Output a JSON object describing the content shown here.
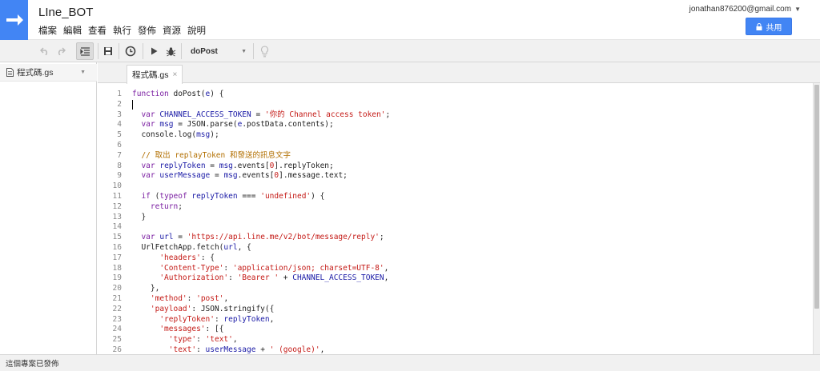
{
  "app": {
    "title": "LIne_BOT"
  },
  "menu": [
    "檔案",
    "編輯",
    "查看",
    "執行",
    "發佈",
    "資源",
    "說明"
  ],
  "account": {
    "email": "jonathan876200@gmail.com"
  },
  "share": {
    "label": "共用"
  },
  "toolbar": {
    "function_select": "doPost",
    "icons": [
      "undo-icon",
      "redo-icon",
      "indent-icon",
      "save-icon",
      "clock-icon",
      "run-icon",
      "debug-icon",
      "lightbulb-icon"
    ]
  },
  "sidebar": {
    "file": "程式碼.gs"
  },
  "tab": {
    "label": "程式碼.gs",
    "close": "×"
  },
  "code": {
    "line_numbers": [
      "1",
      "2",
      "3",
      "4",
      "5",
      "6",
      "7",
      "8",
      "9",
      "10",
      "11",
      "12",
      "13",
      "14",
      "15",
      "16",
      "17",
      "18",
      "19",
      "20",
      "21",
      "22",
      "23",
      "24",
      "25",
      "26"
    ],
    "lines": [
      [
        [
          "k",
          "function "
        ],
        [
          "n",
          "doPost("
        ],
        [
          "v",
          "e"
        ],
        [
          "n",
          ") {"
        ]
      ],
      [
        [
          "cursor",
          ""
        ]
      ],
      [
        [
          "n",
          "  "
        ],
        [
          "k",
          "var "
        ],
        [
          "v",
          "CHANNEL_ACCESS_TOKEN"
        ],
        [
          "n",
          " = "
        ],
        [
          "s",
          "'你的 Channel access token'"
        ],
        [
          "n",
          ";"
        ]
      ],
      [
        [
          "n",
          "  "
        ],
        [
          "k",
          "var "
        ],
        [
          "v",
          "msg"
        ],
        [
          "n",
          " = JSON.parse("
        ],
        [
          "v",
          "e"
        ],
        [
          "n",
          ".postData.contents);"
        ]
      ],
      [
        [
          "n",
          "  console.log("
        ],
        [
          "v",
          "msg"
        ],
        [
          "n",
          ");"
        ]
      ],
      [
        [
          "n",
          ""
        ]
      ],
      [
        [
          "c",
          "  // 取出 replayToken 和發送的訊息文字"
        ]
      ],
      [
        [
          "n",
          "  "
        ],
        [
          "k",
          "var "
        ],
        [
          "v",
          "replyToken"
        ],
        [
          "n",
          " = "
        ],
        [
          "v",
          "msg"
        ],
        [
          "n",
          ".events["
        ],
        [
          "s",
          "0"
        ],
        [
          "n",
          "].replyToken;"
        ]
      ],
      [
        [
          "n",
          "  "
        ],
        [
          "k",
          "var "
        ],
        [
          "v",
          "userMessage"
        ],
        [
          "n",
          " = "
        ],
        [
          "v",
          "msg"
        ],
        [
          "n",
          ".events["
        ],
        [
          "s",
          "0"
        ],
        [
          "n",
          "].message.text;"
        ]
      ],
      [
        [
          "n",
          ""
        ]
      ],
      [
        [
          "n",
          "  "
        ],
        [
          "k",
          "if "
        ],
        [
          "n",
          "("
        ],
        [
          "k",
          "typeof "
        ],
        [
          "v",
          "replyToken"
        ],
        [
          "n",
          " === "
        ],
        [
          "s",
          "'undefined'"
        ],
        [
          "n",
          ") {"
        ]
      ],
      [
        [
          "n",
          "    "
        ],
        [
          "k",
          "return"
        ],
        [
          "n",
          ";"
        ]
      ],
      [
        [
          "n",
          "  }"
        ]
      ],
      [
        [
          "n",
          ""
        ]
      ],
      [
        [
          "n",
          "  "
        ],
        [
          "k",
          "var "
        ],
        [
          "v",
          "url"
        ],
        [
          "n",
          " = "
        ],
        [
          "s",
          "'https://api.line.me/v2/bot/message/reply'"
        ],
        [
          "n",
          ";"
        ]
      ],
      [
        [
          "n",
          "  UrlFetchApp.fetch("
        ],
        [
          "v",
          "url"
        ],
        [
          "n",
          ", {"
        ]
      ],
      [
        [
          "n",
          "      "
        ],
        [
          "s",
          "'headers'"
        ],
        [
          "n",
          ": {"
        ]
      ],
      [
        [
          "n",
          "      "
        ],
        [
          "s",
          "'Content-Type'"
        ],
        [
          "n",
          ": "
        ],
        [
          "s",
          "'application/json; charset=UTF-8'"
        ],
        [
          "n",
          ","
        ]
      ],
      [
        [
          "n",
          "      "
        ],
        [
          "s",
          "'Authorization'"
        ],
        [
          "n",
          ": "
        ],
        [
          "s",
          "'Bearer '"
        ],
        [
          "n",
          " + "
        ],
        [
          "v",
          "CHANNEL_ACCESS_TOKEN"
        ],
        [
          "n",
          ","
        ]
      ],
      [
        [
          "n",
          "    },"
        ]
      ],
      [
        [
          "n",
          "    "
        ],
        [
          "s",
          "'method'"
        ],
        [
          "n",
          ": "
        ],
        [
          "s",
          "'post'"
        ],
        [
          "n",
          ","
        ]
      ],
      [
        [
          "n",
          "    "
        ],
        [
          "s",
          "'payload'"
        ],
        [
          "n",
          ": JSON.stringify({"
        ]
      ],
      [
        [
          "n",
          "      "
        ],
        [
          "s",
          "'replyToken'"
        ],
        [
          "n",
          ": "
        ],
        [
          "v",
          "replyToken"
        ],
        [
          "n",
          ","
        ]
      ],
      [
        [
          "n",
          "      "
        ],
        [
          "s",
          "'messages'"
        ],
        [
          "n",
          ": [{"
        ]
      ],
      [
        [
          "n",
          "        "
        ],
        [
          "s",
          "'type'"
        ],
        [
          "n",
          ": "
        ],
        [
          "s",
          "'text'"
        ],
        [
          "n",
          ","
        ]
      ],
      [
        [
          "n",
          "        "
        ],
        [
          "s",
          "'text'"
        ],
        [
          "n",
          ": "
        ],
        [
          "v",
          "userMessage"
        ],
        [
          "n",
          " + "
        ],
        [
          "s",
          "' (google)'"
        ],
        [
          "n",
          ","
        ]
      ]
    ]
  },
  "status": {
    "text": "這個專案已發佈"
  },
  "colors": {
    "accent": "#4285f4",
    "keyword": "#7b1fa2",
    "variable": "#1a1aa6",
    "string": "#c41a16",
    "comment": "#b26f00"
  }
}
